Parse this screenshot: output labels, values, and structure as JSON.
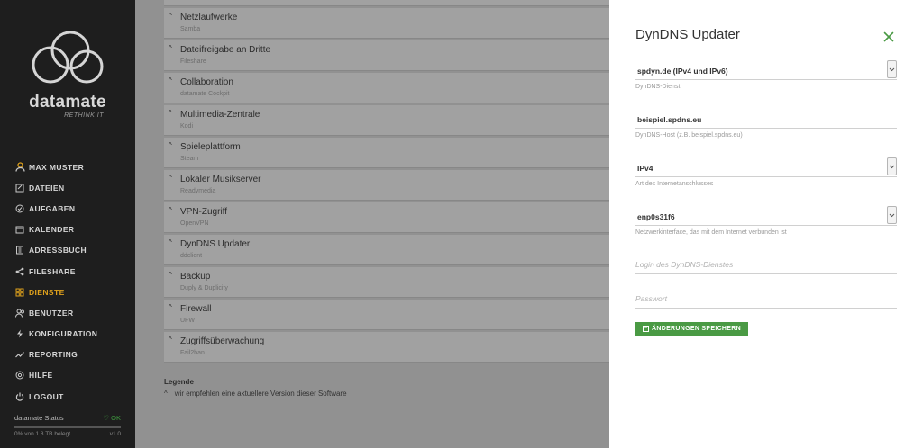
{
  "sidebar": {
    "logo_title": "datamate",
    "logo_subtitle": "RETHINK IT",
    "items": [
      {
        "label": "MAX MUSTER",
        "icon": "user-icon"
      },
      {
        "label": "DATEIEN",
        "icon": "file-icon"
      },
      {
        "label": "AUFGABEN",
        "icon": "tasks-icon"
      },
      {
        "label": "KALENDER",
        "icon": "calendar-icon"
      },
      {
        "label": "ADRESSBUCH",
        "icon": "addressbook-icon"
      },
      {
        "label": "FILESHARE",
        "icon": "share-icon"
      },
      {
        "label": "DIENSTE",
        "icon": "services-icon",
        "active": true
      },
      {
        "label": "BENUTZER",
        "icon": "users-icon"
      },
      {
        "label": "KONFIGURATION",
        "icon": "config-icon"
      },
      {
        "label": "REPORTING",
        "icon": "chart-icon"
      },
      {
        "label": "HILFE",
        "icon": "help-icon"
      },
      {
        "label": "LOGOUT",
        "icon": "power-icon"
      }
    ],
    "status_label": "datamate Status",
    "status_ok": "OK",
    "usage": "0% von 1.8 TB belegt",
    "version": "v1.0",
    "accent": "#e0a21c"
  },
  "services": [
    {
      "name": "Netzlaufwerke",
      "sub": "Samba",
      "mark": "#2a5aa8"
    },
    {
      "name": "Dateifreigabe an Dritte",
      "sub": "Fileshare",
      "mark": "#2a5aa8"
    },
    {
      "name": "Collaboration",
      "sub": "datamate Cockpit",
      "mark": "#2a5aa8"
    },
    {
      "name": "Multimedia-Zentrale",
      "sub": "Kodi",
      "mark": "#b0302a"
    },
    {
      "name": "Spieleplattform",
      "sub": "Steam",
      "mark": "#b0302a"
    },
    {
      "name": "Lokaler Musikserver",
      "sub": "Readymedia",
      "mark": "#b0302a"
    },
    {
      "name": "VPN-Zugriff",
      "sub": "OpenVPN",
      "mark": "#3a9a8a"
    },
    {
      "name": "DynDNS Updater",
      "sub": "ddclient",
      "mark": "#3a9a8a"
    },
    {
      "name": "Backup",
      "sub": "Duply & Duplicity",
      "mark": "#e09a1c"
    },
    {
      "name": "Firewall",
      "sub": "UFW",
      "mark": "#e09a1c"
    },
    {
      "name": "Zugriffsüberwachung",
      "sub": "Fail2ban",
      "mark": "#e09a1c"
    }
  ],
  "legend": {
    "title": "Legende",
    "item": "wir empfehlen eine aktuellere Version dieser Software"
  },
  "panel": {
    "title": "DynDNS Updater",
    "service": {
      "value": "spdyn.de (IPv4 und IPv6)",
      "hint": "DynDNS-Dienst"
    },
    "host": {
      "value": "beispiel.spdns.eu",
      "hint": "DynDNS-Host (z.B. beispiel.spdns.eu)"
    },
    "connection": {
      "value": "IPv4",
      "hint": "Art des Internetanschlusses"
    },
    "interface": {
      "value": "enp0s31f6",
      "hint": "Netzwerkinterface, das mit dem Internet verbunden ist"
    },
    "login": {
      "placeholder": "Login des DynDNS-Dienstes"
    },
    "password": {
      "placeholder": "Passwort"
    },
    "save_label": "ÄNDERUNGEN SPEICHERN",
    "accent": "#4a9a44"
  }
}
